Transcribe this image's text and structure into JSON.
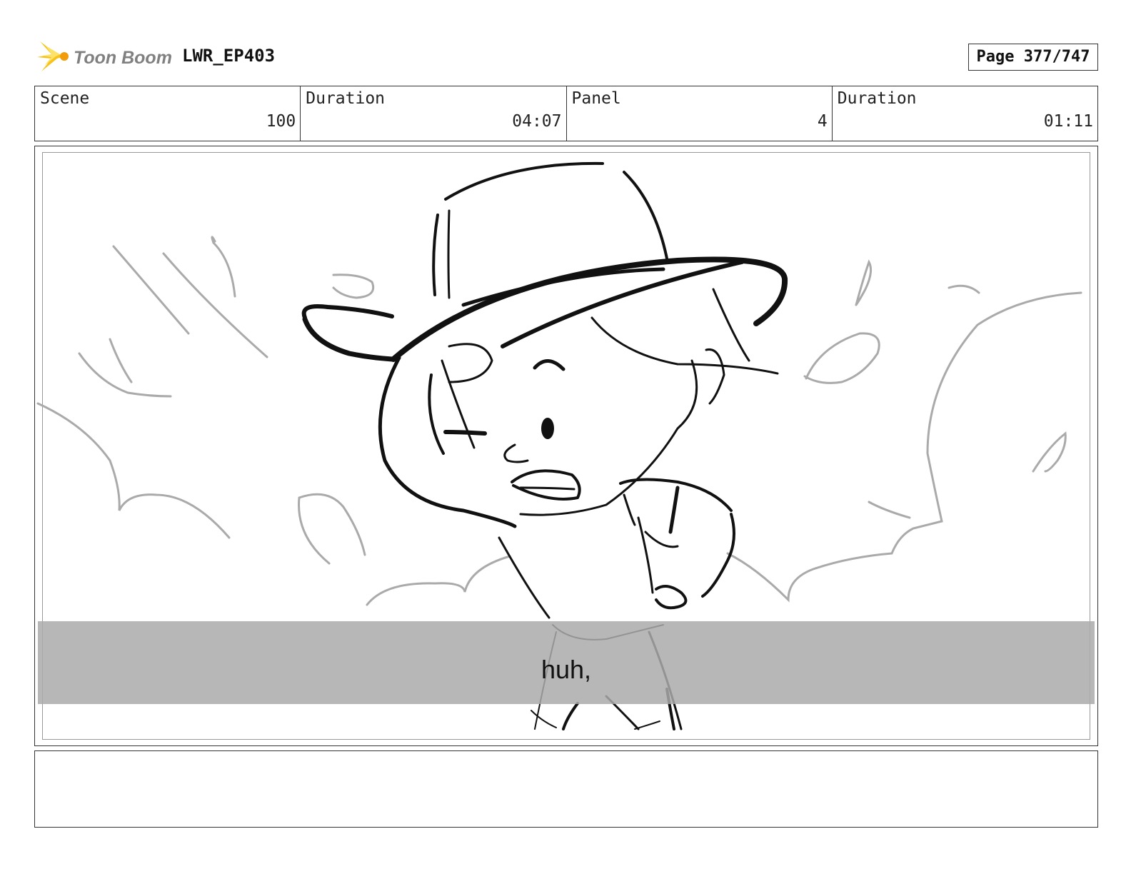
{
  "header": {
    "brand": "Toon Boom",
    "project": "LWR_EP403",
    "page": "Page 377/747"
  },
  "info": {
    "scene_label": "Scene",
    "scene_value": "100",
    "duration_label": "Duration",
    "duration_value": "04:07",
    "panel_label": "Panel",
    "panel_value": "4",
    "panel_duration_label": "Duration",
    "panel_duration_value": "01:11"
  },
  "panel": {
    "dialogue": "huh,"
  },
  "notes": {
    "text": ""
  }
}
